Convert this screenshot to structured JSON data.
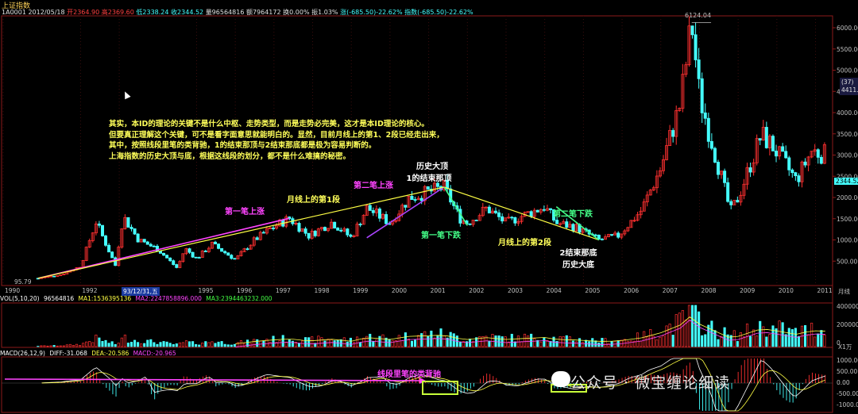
{
  "header": {
    "index_name": "上证指数",
    "info": {
      "code_date": "1A0001 2012/05/18",
      "open": "开2364.90",
      "high": "高2369.60",
      "low": "低2338.24",
      "close": "收2344.52",
      "volume": "量96564816",
      "amount": "额7964172",
      "turnover": "换0.00%",
      "amplitude": "振1.03%",
      "change": "涨(-685.50)-22.62%",
      "index_change": "指数(-685.50)-22.62%"
    }
  },
  "annotations": {
    "note_lines": [
      "其实，本ID的理论的关键不是什么中枢、走势类型，而是走势必完美，这才是本ID理论的核心。",
      "但要真正理解这个关键，可不是看字面意思就能明白的。显然，目前月线上的第1、2段已经走出来，",
      "其中，按照线段里笔的类背驰，1的结束那顶与2结束那底都是极为容易判断的。",
      "上海指数的历史大顶与底，根据这线段的划分，都不是什么难搞的秘密。"
    ],
    "first_up": "第一笔上涨",
    "second_up": "第二笔上涨",
    "monthly_seg1": "月线上的第1段",
    "top_line1": "历史大顶",
    "top_line2": "1的结束那顶",
    "first_down": "第一笔下跌",
    "second_down": "第二笔下跌",
    "monthly_seg2": "月线上的第2段",
    "bottom_line1": "2结束那底",
    "bottom_line2": "历史大底",
    "macd_note": "线段里笔的类背驰",
    "peak_value": "6124.04",
    "low_value": "95.79",
    "current_badge": "(37)",
    "current_badge2": "4411.82",
    "current_price": "2344.52",
    "cursor_date": "93/12/31,五"
  },
  "volume_panel": {
    "title": "VOL(5,10,20)",
    "value": "96564816",
    "ma1": "MA1:1536395136",
    "ma2": "MA2:2247858896.000",
    "ma3": "MA3:2394463232.000",
    "y_ticks": [
      "400000",
      "200000",
      "0"
    ],
    "unit": "X1万"
  },
  "macd_panel": {
    "title": "MACD(26,12,9)",
    "diff": "DIFF:-31.068",
    "dea": "DEA:-20.586",
    "macd": "MACD:-20.965",
    "y_ticks": [
      "1000.00",
      "500.00",
      "0.00",
      "-500.00",
      "-1000.00"
    ]
  },
  "y_ticks": [
    "6000.00",
    "5500.00",
    "5000.00",
    "4500.00",
    "4000.00",
    "3500.00",
    "3000.00",
    "2500.00",
    "2000.00",
    "1500.00",
    "1000.00",
    "500.00"
  ],
  "x_unit": "月线",
  "watermark": "公众号 · 微宝缠论细读",
  "colors": {
    "up": "#ff3030",
    "down": "#44ffff",
    "first_seg": "#ff44ff",
    "second_seg": "#ffff44",
    "down_stroke": "#44ff88"
  },
  "chart_data": {
    "type": "line",
    "title": "上证指数",
    "xlabel": "",
    "ylabel": "",
    "x_ticks": [
      "1990",
      "1992",
      "1993",
      "1995",
      "1996",
      "1997",
      "1998",
      "1999",
      "2000",
      "2001",
      "2002",
      "2003",
      "2004",
      "2005",
      "2006",
      "2007",
      "2008",
      "2009",
      "2010",
      "2011"
    ],
    "ylim": [
      0,
      6500
    ],
    "series": [
      {
        "name": "",
        "x": [
          1990.9,
          1991.5,
          1992.0,
          1992.4,
          1992.9,
          1993.1,
          1993.5,
          1994.0,
          1994.5,
          1994.7,
          1995.0,
          1995.4,
          1996.0,
          1996.5,
          1996.9,
          1997.4,
          1997.9,
          1998.5,
          1999.0,
          1999.4,
          1999.5,
          2000.0,
          2000.5,
          2001.0,
          2001.4,
          2001.8,
          2002.0,
          2002.5,
          2003.0,
          2003.5,
          2004.0,
          2004.3,
          2004.8,
          2005.0,
          2005.4,
          2005.9,
          2006.5,
          2007.0,
          2007.5,
          2007.8,
          2008.0,
          2008.5,
          2008.8,
          2009.0,
          2009.6,
          2009.9,
          2010.5,
          2010.9,
          2011.3
        ],
        "y": [
          96,
          180,
          380,
          1429,
          400,
          1558,
          1000,
          780,
          333,
          800,
          560,
          900,
          540,
          1000,
          1258,
          1510,
          1100,
          1420,
          1050,
          1750,
          1700,
          1400,
          2000,
          2130,
          2245,
          1514,
          1400,
          1748,
          1400,
          1600,
          1780,
          1400,
          1300,
          1200,
          1000,
          1100,
          1700,
          2700,
          4200,
          6124,
          4400,
          2700,
          1664,
          2000,
          3478,
          3200,
          2400,
          3100,
          3000
        ]
      }
    ],
    "pen_segments": [
      {
        "name": "第一笔上涨",
        "from": [
          1990.9,
          96
        ],
        "to": [
          1997.4,
          1510
        ]
      },
      {
        "name": "第二笔上涨",
        "from": [
          1999.4,
          1050
        ],
        "to": [
          2001.4,
          2245
        ]
      },
      {
        "name": "月线上的第1段",
        "from": [
          1990.9,
          96
        ],
        "to": [
          2001.4,
          2245
        ]
      },
      {
        "name": "月线上的第2段",
        "from": [
          2001.4,
          2245
        ],
        "to": [
          2005.4,
          998
        ]
      },
      {
        "name": "第一笔下跌",
        "from": [
          2001.4,
          2245
        ],
        "to": [
          2002.0,
          1339
        ]
      },
      {
        "name": "第二笔下跌",
        "from": [
          2004.3,
          1783
        ],
        "to": [
          2005.4,
          998
        ]
      }
    ]
  }
}
